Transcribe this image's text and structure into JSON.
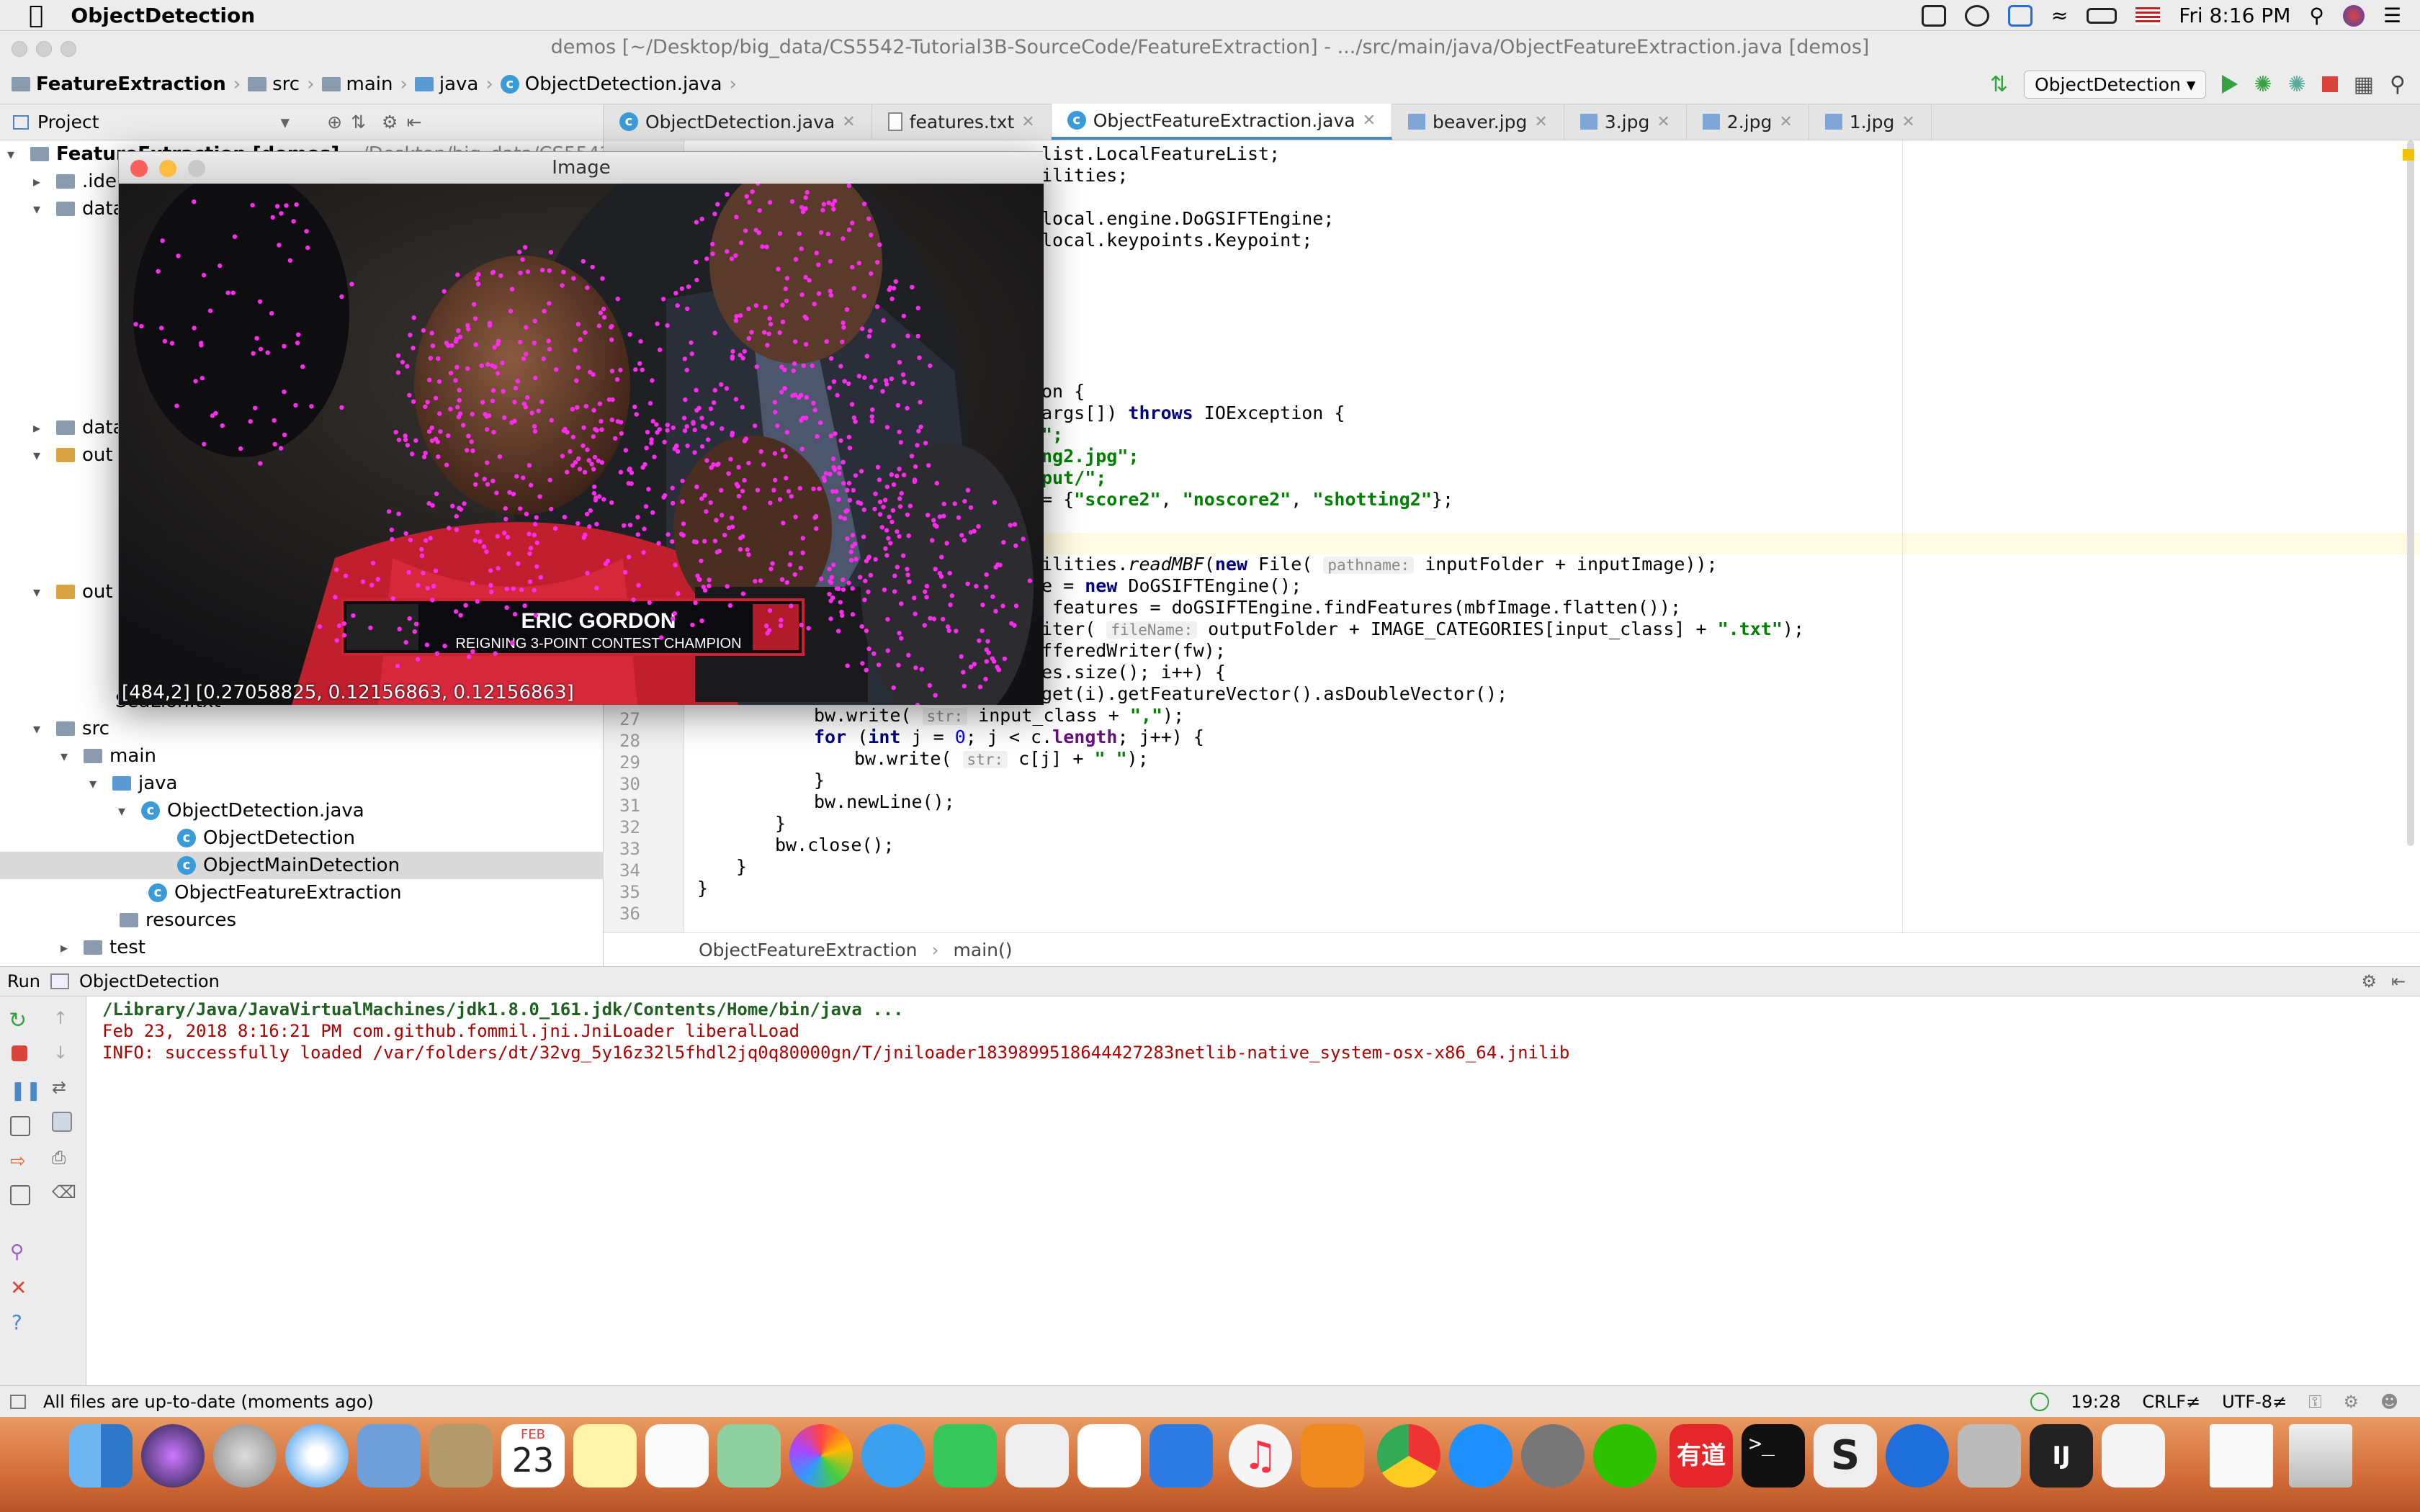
{
  "menubar": {
    "app_name": "ObjectDetection",
    "clock": "Fri 8:16 PM"
  },
  "window": {
    "title": "demos [~/Desktop/big_data/CS5542-Tutorial3B-SourceCode/FeatureExtraction] - .../src/main/java/ObjectFeatureExtraction.java [demos]"
  },
  "breadcrumb": [
    "FeatureExtraction",
    "src",
    "main",
    "java",
    "ObjectDetection.java"
  ],
  "run_config": "ObjectDetection",
  "project_panel": {
    "title": "Project"
  },
  "tabs": [
    "ObjectDetection.java",
    "features.txt",
    "ObjectFeatureExtraction.java",
    "beaver.jpg",
    "3.jpg",
    "2.jpg",
    "1.jpg"
  ],
  "tree": {
    "root": "FeatureExtraction [demos]",
    "root_path": "~/Desktop/big_data/CS5542-Tut",
    "idea": ".ide",
    "data1": "data",
    "data2": "data",
    "out1": "out",
    "out2": "out",
    "seaLion": "SeaLion.txt",
    "src": "src",
    "main": "main",
    "java": "java",
    "objdet_java": "ObjectDetection.java",
    "objdet": "ObjectDetection",
    "objmain": "ObjectMainDetection",
    "objfeat": "ObjectFeatureExtraction",
    "resources": "resources",
    "test": "test"
  },
  "code": {
    "l1": "list.LocalFeatureList;",
    "l2": "ilities;",
    "l3": "local.engine.DoGSIFTEngine;",
    "l4": "local.keypoints.Keypoint;",
    "l5": "on {",
    "l6a": "args[]) ",
    "l6b": "throws",
    "l6c": " IOException {",
    "l7": "\";",
    "l8": "ng2.jpg\";",
    "l9": "put/\";",
    "l10a": "= {",
    "l10b": "\"score2\"",
    "l10c": ", ",
    "l10d": "\"noscore2\"",
    "l10e": ", ",
    "l10f": "\"shotting2\"",
    "l10g": "};",
    "l11a": "ilities.",
    "l11b": "readMBF",
    "l11c": "(",
    "l11d": "new",
    "l11e": " File( ",
    "l11hint": "pathname:",
    "l11f": " inputFolder + inputImage));",
    "l12a": "e = ",
    "l12b": "new",
    "l12c": " DoGSIFTEngine();",
    "l13": " features = doGSIFTEngine.findFeatures(mbfImage.flatten());",
    "l14a": "iter( ",
    "l14hint": "fileName:",
    "l14b": " outputFolder + IMAGE_CATEGORIES[input_class] + ",
    "l14c": "\".txt\"",
    "l14d": ");",
    "l15": "fferedWriter(fw);",
    "l16": "es.size(); i++) {",
    "l17": "get(i).getFeatureVector().asDoubleVector();",
    "l27a": "bw.write( ",
    "l27hint": "str:",
    "l27b": " input_class + ",
    "l27c": "\",\"",
    "l27d": ");",
    "l28a": "for",
    "l28b": " (",
    "l28c": "int",
    "l28d": " j = ",
    "l28e": "0",
    "l28f": "; j < c.",
    "l28g": "length",
    "l28h": "; j++) {",
    "l29a": "bw.write( ",
    "l29hint": "str:",
    "l29b": " c[j] + ",
    "l29c": "\" \"",
    "l29d": ");",
    "l30": "}",
    "l31": "bw.newLine();",
    "l32": "}",
    "l33": "bw.close();",
    "l34": "}",
    "l35": "}",
    "line_numbers": [
      "27",
      "28",
      "29",
      "30",
      "31",
      "32",
      "33",
      "34",
      "35",
      "36"
    ]
  },
  "editor_breadcrumb": [
    "ObjectFeatureExtraction",
    "main()"
  ],
  "run_panel": {
    "label": "Run",
    "config": "ObjectDetection"
  },
  "console": {
    "line1": "/Library/Java/JavaVirtualMachines/jdk1.8.0_161.jdk/Contents/Home/bin/java ...",
    "line2": "Feb 23, 2018 8:16:21 PM com.github.fommil.jni.JniLoader liberalLoad",
    "line3": "INFO: successfully loaded /var/folders/dt/32vg_5y16z32l5fhdl2jq0q80000gn/T/jniloader1839899518644427283netlib-native_system-osx-x86_64.jnilib"
  },
  "status": {
    "message": "All files are up-to-date (moments ago)",
    "position": "19:28",
    "line_sep": "CRLF≠",
    "encoding": "UTF-8≠"
  },
  "image_window": {
    "title": "Image",
    "pixel_readout": "[484,2] [0.27058825, 0.12156863, 0.12156863]",
    "banner_name": "ERIC GORDON",
    "banner_sub": "REIGNING 3-POINT CONTEST CHAMPION"
  },
  "dock": {
    "calendar_month": "FEB",
    "calendar_day": "23",
    "youdao": "有道"
  },
  "colors": {
    "keypoint": "#ff2cf0",
    "accent": "#4a88c7",
    "error_text": "#b00000"
  }
}
